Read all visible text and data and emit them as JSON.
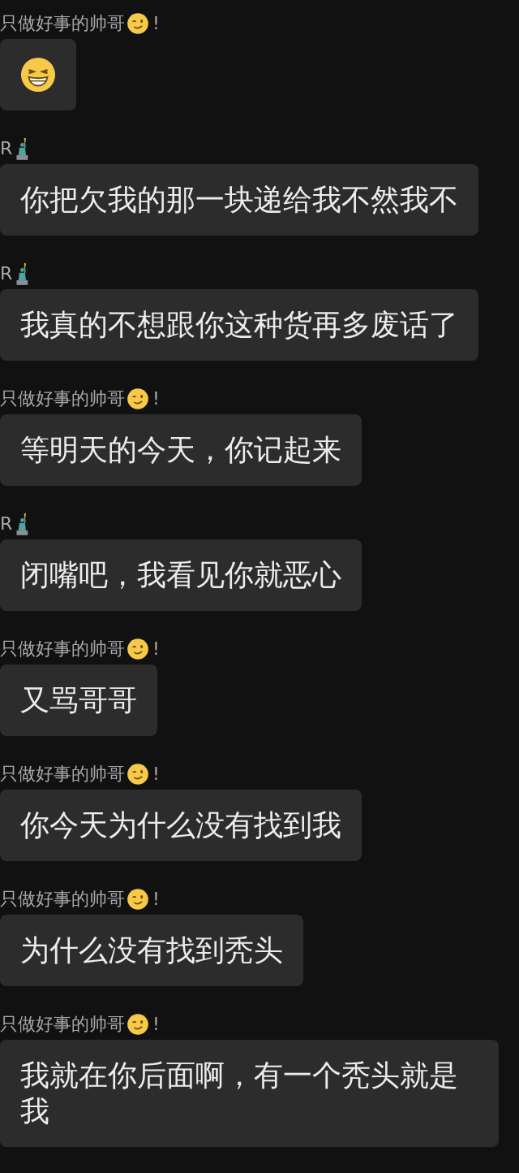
{
  "messages": [
    {
      "sender": {
        "name": "只做好事的帅哥",
        "icon": {
          "kind": "wink"
        },
        "suffix": "!"
      },
      "kind": "emoji",
      "icon": {
        "kind": "grin"
      }
    },
    {
      "sender": {
        "name": "R",
        "icon": {
          "kind": "statue"
        }
      },
      "kind": "text",
      "text": "你把欠我的那一块递给我不然我不"
    },
    {
      "sender": {
        "name": "R",
        "icon": {
          "kind": "statue"
        }
      },
      "kind": "text",
      "text": "我真的不想跟你这种货再多废话了"
    },
    {
      "sender": {
        "name": "只做好事的帅哥",
        "icon": {
          "kind": "wink"
        },
        "suffix": "!"
      },
      "kind": "text",
      "text": "等明天的今天，你记起来"
    },
    {
      "sender": {
        "name": "R",
        "icon": {
          "kind": "statue"
        }
      },
      "kind": "text",
      "text": "闭嘴吧，我看见你就恶心"
    },
    {
      "sender": {
        "name": "只做好事的帅哥",
        "icon": {
          "kind": "wink"
        },
        "suffix": "!"
      },
      "kind": "text",
      "text": "又骂哥哥"
    },
    {
      "sender": {
        "name": "只做好事的帅哥",
        "icon": {
          "kind": "wink"
        },
        "suffix": "!"
      },
      "kind": "text",
      "text": "你今天为什么没有找到我"
    },
    {
      "sender": {
        "name": "只做好事的帅哥",
        "icon": {
          "kind": "wink"
        },
        "suffix": "!"
      },
      "kind": "text",
      "text": "为什么没有找到秃头"
    },
    {
      "sender": {
        "name": "只做好事的帅哥",
        "icon": {
          "kind": "wink"
        },
        "suffix": "!"
      },
      "kind": "text",
      "text": "我就在你后面啊，有一个秃头就是我"
    }
  ]
}
